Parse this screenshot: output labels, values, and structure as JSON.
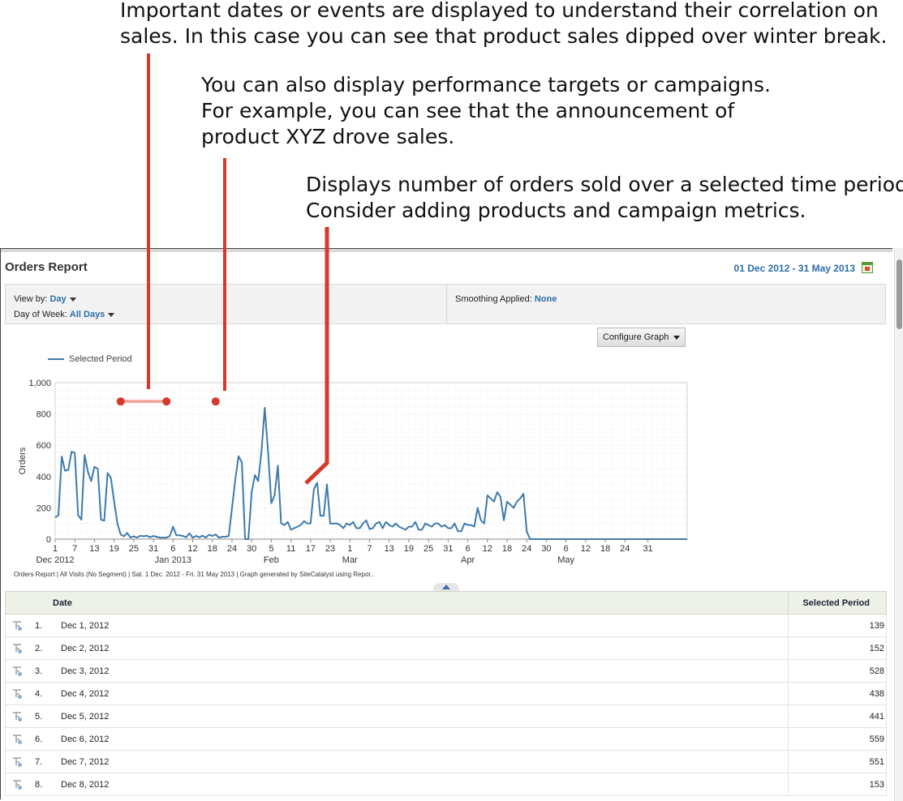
{
  "annotations": [
    {
      "id": "events",
      "lines": [
        "Important dates or events are displayed to understand their correlation on",
        "sales. In this case you can see that product sales dipped over winter break."
      ]
    },
    {
      "id": "targets",
      "lines": [
        "You can also display performance targets or campaigns.",
        "For example, you can see that the announcement of",
        "product XYZ drove sales."
      ]
    },
    {
      "id": "orders",
      "lines": [
        "Displays number of orders sold over a selected time period.",
        "Consider adding products and campaign metrics."
      ]
    }
  ],
  "colors": {
    "annotation_red": "#d63a2a",
    "series_blue": "#3e7bab",
    "link_blue": "#2e6da4"
  },
  "header": {
    "title": "Orders Report",
    "date_range": "01 Dec 2012 - 31 May 2013",
    "calendar_icon": "calendar-icon"
  },
  "options": {
    "view_by_label": "View by:",
    "view_by_value": "Day",
    "day_of_week_label": "Day of Week:",
    "day_of_week_value": "All Days",
    "smoothing_label": "Smoothing Applied:",
    "smoothing_value": "None"
  },
  "configure_graph": {
    "label": "Configure Graph"
  },
  "chart_data": {
    "type": "line",
    "ylabel": "Orders",
    "ylim": [
      0,
      1000
    ],
    "yticks": [
      "0",
      "200",
      "400",
      "600",
      "800",
      "1,000"
    ],
    "grid": true,
    "legend": "top-left",
    "series": [
      {
        "name": "Selected Period",
        "values": [
          139,
          152,
          528,
          438,
          441,
          559,
          551,
          153,
          125,
          538,
          430,
          370,
          462,
          450,
          124,
          118,
          423,
          392,
          240,
          100,
          30,
          18,
          40,
          10,
          18,
          10,
          22,
          18,
          22,
          12,
          20,
          15,
          10,
          10,
          10,
          20,
          80,
          25,
          25,
          20,
          12,
          38,
          10,
          20,
          12,
          22,
          10,
          28,
          20,
          30,
          10,
          15,
          15,
          20,
          200,
          380,
          530,
          490,
          0,
          0,
          300,
          410,
          370,
          560,
          840,
          560,
          230,
          280,
          470,
          100,
          90,
          110,
          60,
          70,
          80,
          90,
          115,
          100,
          100,
          320,
          360,
          150,
          150,
          350,
          100,
          100,
          100,
          90,
          70,
          100,
          90,
          110,
          70,
          70,
          100,
          120,
          65,
          70,
          100,
          110,
          70,
          110,
          90,
          80,
          100,
          80,
          70,
          60,
          80,
          80,
          110,
          60,
          60,
          100,
          90,
          80,
          100,
          100,
          80,
          90,
          70,
          70,
          100,
          50,
          50,
          100,
          90,
          90,
          80,
          200,
          120,
          100,
          280,
          260,
          240,
          300,
          270,
          120,
          240,
          220,
          200,
          240,
          260,
          290,
          50,
          0,
          0,
          0,
          0,
          0,
          0,
          0,
          0,
          0,
          0,
          0,
          0,
          0,
          0,
          0,
          0,
          0,
          0,
          0,
          0,
          0,
          0,
          0,
          0,
          0,
          0,
          0,
          0,
          0,
          0,
          0,
          0,
          0,
          0,
          0,
          0,
          0,
          0,
          0,
          0,
          0,
          0,
          0,
          0,
          0,
          0,
          0,
          0,
          0
        ]
      }
    ],
    "x_tick_labels": [
      "1",
      "7",
      "13",
      "19",
      "25",
      "31",
      "6",
      "12",
      "18",
      "24",
      "30",
      "5",
      "11",
      "17",
      "23",
      "1",
      "7",
      "13",
      "19",
      "25",
      "31",
      "6",
      "12",
      "18",
      "24",
      "30",
      "6",
      "12",
      "18",
      "24",
      "31"
    ],
    "x_tick_days": [
      0,
      6,
      12,
      18,
      24,
      30,
      36,
      42,
      48,
      54,
      60,
      66,
      72,
      78,
      84,
      90,
      96,
      102,
      108,
      114,
      120,
      126,
      132,
      138,
      144,
      150,
      156,
      162,
      168,
      174,
      181
    ],
    "month_labels": [
      {
        "label": "Dec 2012",
        "day": 0
      },
      {
        "label": "Jan 2013",
        "day": 36
      },
      {
        "label": "Feb",
        "day": 66
      },
      {
        "label": "Mar",
        "day": 90
      },
      {
        "label": "Apr",
        "day": 126
      },
      {
        "label": "May",
        "day": 156
      }
    ],
    "event_markers": [
      {
        "type": "range",
        "start_day": 20,
        "end_day": 34,
        "value": 880
      },
      {
        "type": "point",
        "day": 49,
        "value": 880
      }
    ]
  },
  "footer_note": "Orders Report | All Visits (No Segment) | Sat.  1 Dec. 2012 - Fri. 31 May 2013 | Graph generated by SiteCatalyst using Repor..",
  "table": {
    "headers": {
      "date": "Date",
      "period": "Selected Period"
    },
    "rows": [
      {
        "index": "1.",
        "date": "Dec 1, 2012",
        "value": "139"
      },
      {
        "index": "2.",
        "date": "Dec 2, 2012",
        "value": "152"
      },
      {
        "index": "3.",
        "date": "Dec 3, 2012",
        "value": "528"
      },
      {
        "index": "4.",
        "date": "Dec 4, 2012",
        "value": "438"
      },
      {
        "index": "5.",
        "date": "Dec 5, 2012",
        "value": "441"
      },
      {
        "index": "6.",
        "date": "Dec 6, 2012",
        "value": "559"
      },
      {
        "index": "7.",
        "date": "Dec 7, 2012",
        "value": "551"
      },
      {
        "index": "8.",
        "date": "Dec 8, 2012",
        "value": "153"
      }
    ]
  }
}
